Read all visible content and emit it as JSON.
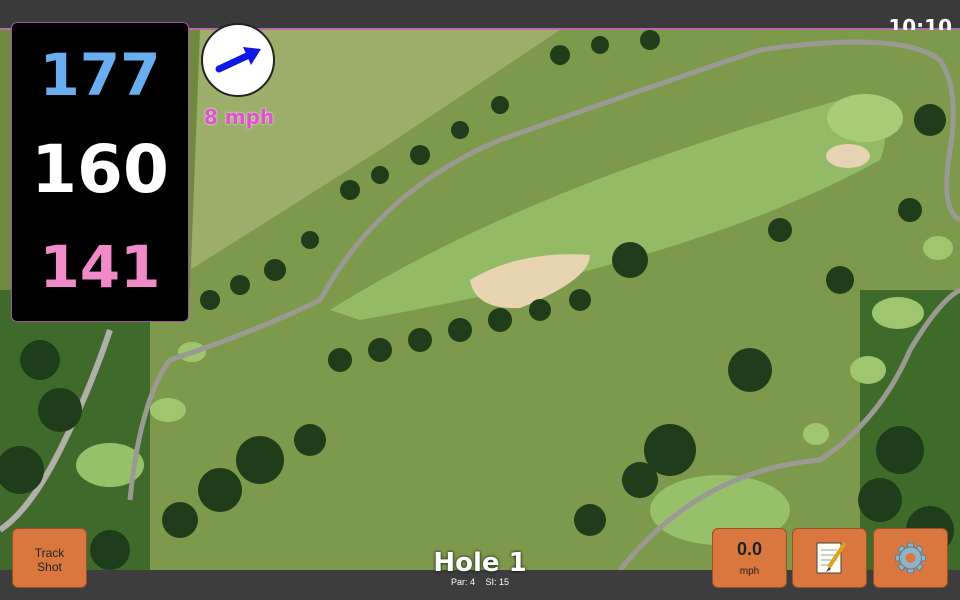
{
  "status": {
    "time": "10:10"
  },
  "distances": {
    "back": "177",
    "middle": "160",
    "front": "141"
  },
  "wind": {
    "speed": "8 mph",
    "icon": "wind-direction-arrow-icon"
  },
  "hole": {
    "title": "Hole 1",
    "par": "Par: 4",
    "stroke_index": "SI: 15"
  },
  "buttons": {
    "track_shot_line1": "Track",
    "track_shot_line2": "Shot",
    "speed_value": "0.0",
    "speed_unit": "mph",
    "notes_icon": "notepad-icon",
    "settings_icon": "gear-icon"
  },
  "colors": {
    "back_distance": "#69aff0",
    "middle_distance": "#ffffff",
    "front_distance": "#f08ac8",
    "wind_text": "#e24fd2",
    "button": "#d9773f"
  }
}
